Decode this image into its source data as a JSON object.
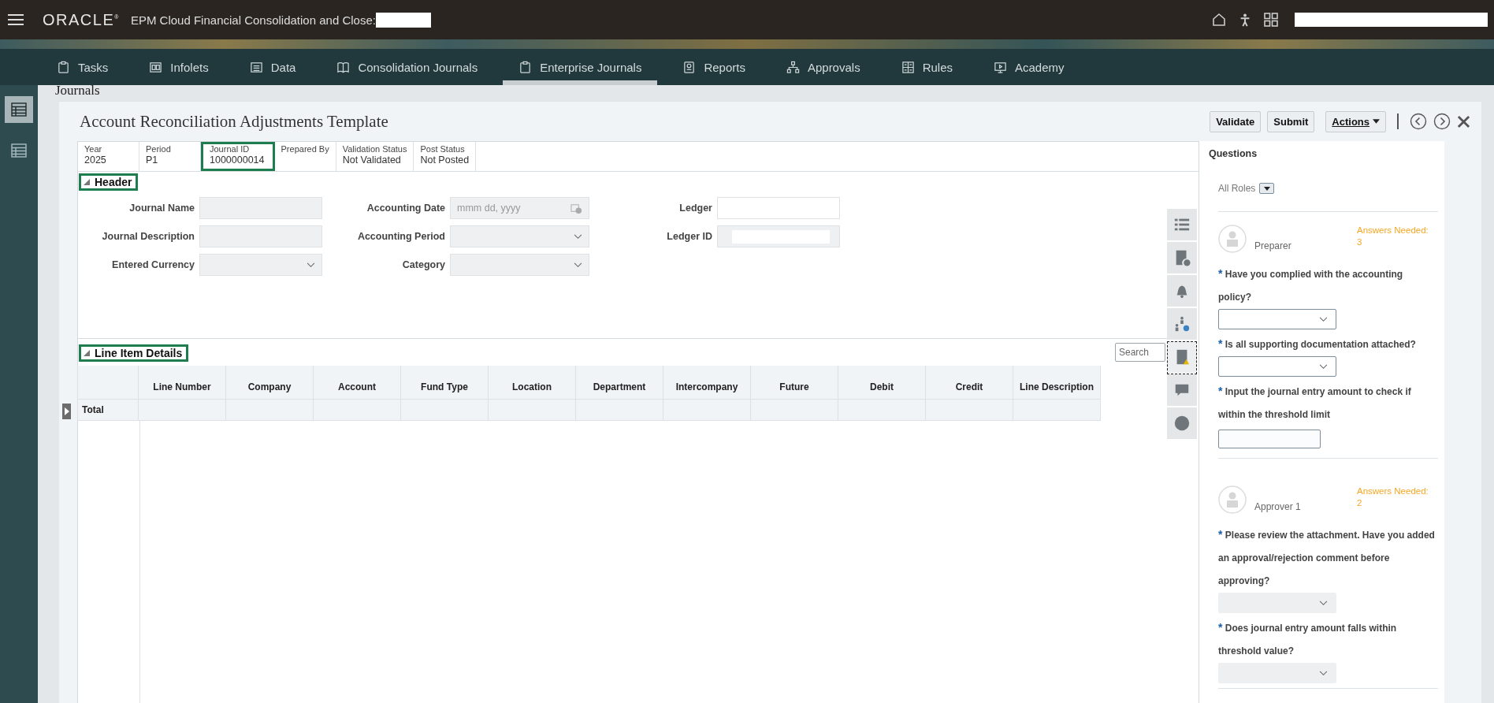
{
  "app_bar": {
    "brand": "ORACLE$^{®}$",
    "title": "EPM Cloud Financial Consolidation and Close:"
  },
  "nav_tabs": [
    {
      "label": "Tasks",
      "selected": false
    },
    {
      "label": "Infolets",
      "selected": false
    },
    {
      "label": "Data",
      "selected": false
    },
    {
      "label": "Consolidation Journals",
      "selected": false
    },
    {
      "label": "Enterprise Journals",
      "selected": true
    },
    {
      "label": "Reports",
      "selected": false
    },
    {
      "label": "Approvals",
      "selected": false
    },
    {
      "label": "Rules",
      "selected": false
    },
    {
      "label": "Academy",
      "selected": false
    }
  ],
  "left_rail": [
    {
      "selected": true
    },
    {
      "selected": false
    }
  ],
  "breadcrumb": "Journals",
  "journal": {
    "title": "Account Reconciliation Adjustments Template",
    "buttons": [
      "Validate",
      "Submit"
    ],
    "actions_menu": "Actions"
  },
  "info_strip": [
    {
      "label": "Year",
      "value": "2025",
      "highlighted": false
    },
    {
      "label": "Period",
      "value": "P1",
      "highlighted": false
    },
    {
      "label": "Journal ID",
      "value": "1000000014",
      "highlighted": true
    },
    {
      "label": "Prepared By",
      "highlighted": false
    },
    {
      "label": "Validation Status",
      "value": "Not Validated",
      "highlighted": false
    },
    {
      "label": "Post Status",
      "value": "Not Posted",
      "highlighted": false
    }
  ],
  "header_section": {
    "title": "Header",
    "highlighted": true,
    "fields": [
      {
        "label": "Journal Name",
        "kind": "text"
      },
      {
        "label": "Accounting Date",
        "kind": "date",
        "placeholder": "mmm dd, yyyy"
      },
      {
        "label": "Ledger",
        "kind": "redacted"
      },
      {
        "label": "Journal Description",
        "kind": "text"
      },
      {
        "label": "Accounting Period",
        "kind": "select"
      },
      {
        "label": "Ledger ID",
        "kind": "redacted"
      },
      {
        "label": "Entered Currency",
        "kind": "select"
      },
      {
        "label": "Category",
        "kind": "select"
      }
    ]
  },
  "line_items": {
    "title": "Line Item Details",
    "highlighted": true,
    "search": {
      "placeholder": "Search"
    },
    "columns": [
      "Line Number",
      "Company",
      "Account",
      "Fund Type",
      "Location",
      "Department",
      "Intercompany",
      "Future",
      "Debit",
      "Credit",
      "Line Description"
    ],
    "total_label": "Total"
  },
  "side_tools": [
    {
      "selected": false
    },
    {
      "selected": false
    },
    {
      "selected": false
    },
    {
      "selected": false
    },
    {
      "selected": true
    },
    {
      "selected": false
    },
    {
      "selected": false
    }
  ],
  "questions": {
    "title": "Questions",
    "filter": "All Roles",
    "roles": [
      {
        "role": "Preparer",
        "answers_label": "Answers Needed:",
        "answers_count": "3",
        "questions": [
          {
            "marker": "*",
            "text": "Have you complied with the accounting policy?",
            "kind": "select",
            "disabled": false
          },
          {
            "marker": "*",
            "text": "Is all supporting documentation attached?",
            "kind": "select",
            "disabled": false
          },
          {
            "marker": "*",
            "text": "Input the journal entry amount to check if within the threshold limit",
            "kind": "input",
            "disabled": false
          }
        ]
      },
      {
        "role": "Approver 1",
        "answers_label": "Answers Needed:",
        "answers_count": "2",
        "questions": [
          {
            "marker": "*",
            "text": "Please review the attachment. Have you added an approval/rejection comment before approving?",
            "kind": "select",
            "disabled": true
          },
          {
            "marker": "*",
            "text": "Does journal entry amount falls within threshold value?",
            "kind": "select",
            "disabled": true
          }
        ]
      }
    ]
  }
}
